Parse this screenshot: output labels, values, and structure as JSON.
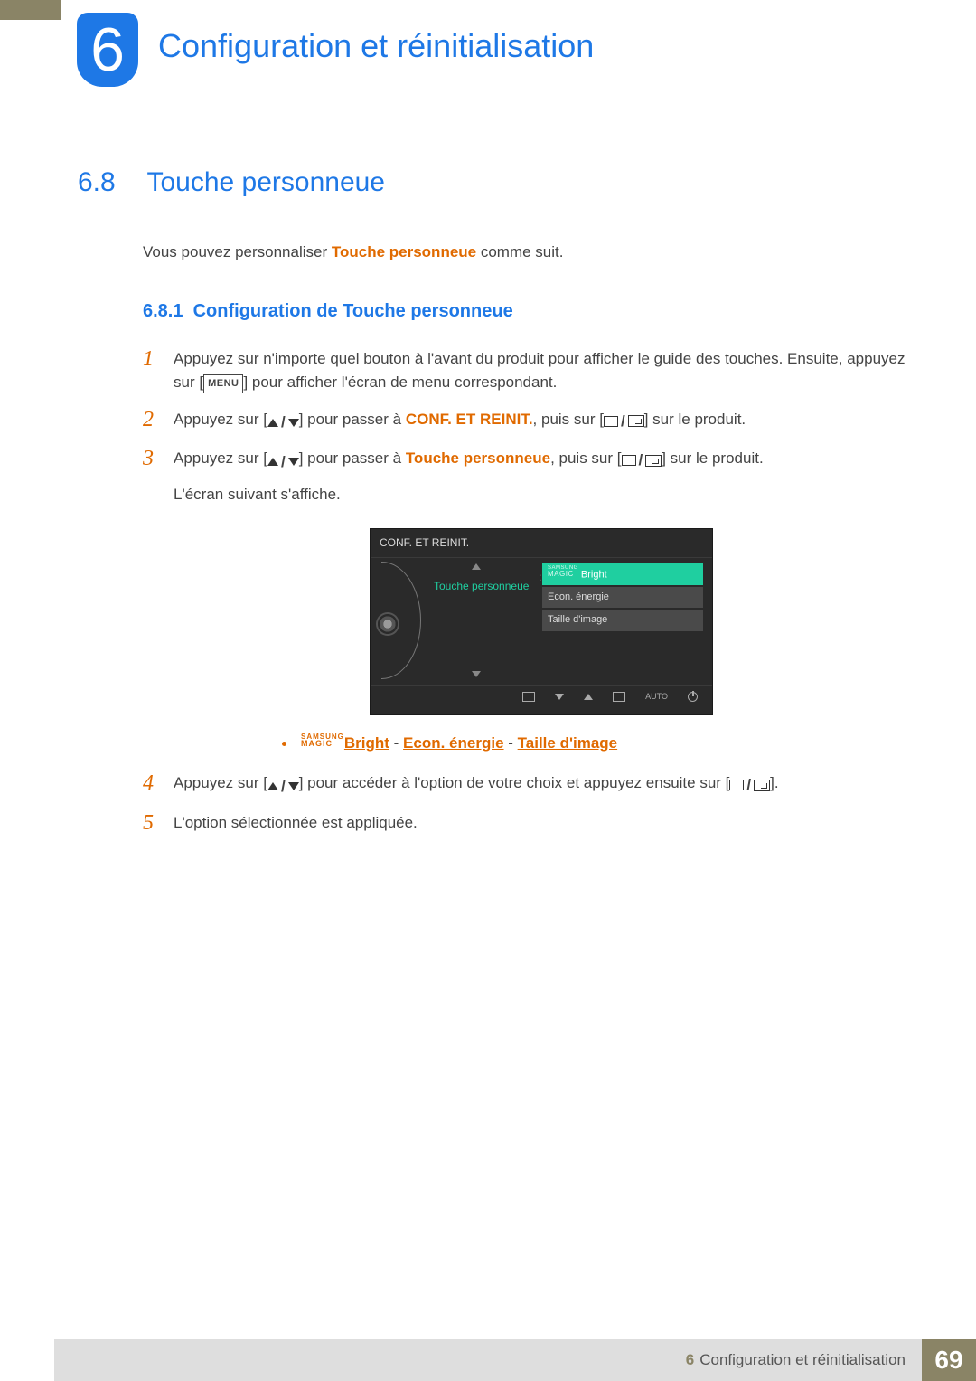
{
  "chapter": {
    "number": "6",
    "title": "Configuration et réinitialisation"
  },
  "section": {
    "number": "6.8",
    "title": "Touche personneue"
  },
  "intro": {
    "before": "Vous pouvez personnaliser ",
    "hl": "Touche personneue",
    "after": " comme suit."
  },
  "subsection": {
    "number": "6.8.1",
    "title": "Configuration de Touche personneue"
  },
  "steps": {
    "s1": {
      "num": "1",
      "a": "Appuyez sur n'importe quel bouton à l'avant du produit pour afficher le guide des touches. Ensuite, appuyez sur [",
      "menu": "MENU",
      "b": "] pour afficher l'écran de menu correspondant."
    },
    "s2": {
      "num": "2",
      "a": "Appuyez sur [",
      "b": "] pour passer à ",
      "hl": "CONF. ET REINIT.",
      "c": ", puis sur [",
      "d": "] sur le produit."
    },
    "s3": {
      "num": "3",
      "a": "Appuyez sur [",
      "b": "] pour passer à ",
      "hl": "Touche personneue",
      "c": ", puis sur [",
      "d": "] sur le produit.",
      "e": "L'écran suivant s'affiche."
    },
    "s4": {
      "num": "4",
      "a": "Appuyez sur [",
      "b": "] pour accéder à l'option de votre choix et appuyez ensuite sur [",
      "c": "]."
    },
    "s5": {
      "num": "5",
      "a": "L'option sélectionnée est appliquée."
    }
  },
  "osd": {
    "title": "CONF. ET REINIT.",
    "item": "Touche personneue",
    "sel_magic_top": "SAMSUNG",
    "sel_magic_bot": "MAGIC",
    "sel_label": "Bright",
    "opt1": "Econ. énergie",
    "opt2": "Taille d'image",
    "auto": "AUTO"
  },
  "bullets": {
    "magic_top": "SAMSUNG",
    "magic_bot": "MAGIC",
    "magic_suffix": "Bright",
    "sep": " - ",
    "l2": "Econ. énergie",
    "l3": "Taille d'image"
  },
  "footer": {
    "chap_num": "6",
    "chap_title": "Configuration et réinitialisation",
    "page": "69"
  }
}
